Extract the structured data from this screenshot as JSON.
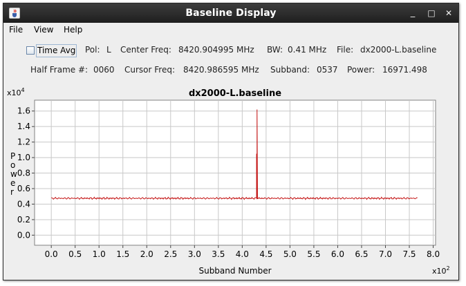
{
  "window": {
    "title": "Baseline Display"
  },
  "window_controls": {
    "minimize": "_",
    "maximize": "□",
    "close": "✕"
  },
  "menu": {
    "file": "File",
    "view": "View",
    "help": "Help"
  },
  "controls": {
    "time_avg_label": "Time Avg",
    "time_avg_checked": false
  },
  "info": {
    "pol_label": "Pol:",
    "pol_value": "L",
    "center_freq_label": "Center Freq:",
    "center_freq_value": "8420.904995 MHz",
    "bw_label": "BW:",
    "bw_value": "0.41 MHz",
    "file_label": "File:",
    "file_value": "dx2000-L.baseline",
    "half_frame_label": "Half Frame #:",
    "half_frame_value": "0060",
    "cursor_freq_label": "Cursor Freq:",
    "cursor_freq_value": "8420.986595 MHz",
    "subband_label": "Subband:",
    "subband_value": "0537",
    "power_label": "Power:",
    "power_value": "16971.498"
  },
  "icons": {
    "app": "java-cup-icon"
  },
  "colors": {
    "series": "#c41414",
    "grid": "#c8c8c8",
    "plot_bg": "#ffffff"
  },
  "chart_data": {
    "type": "line",
    "title": "dx2000-L.baseline",
    "xlabel": "Subband Number",
    "ylabel": "Power",
    "x_multiplier": "x10",
    "x_multiplier_exp": "2",
    "y_multiplier": "x10",
    "y_multiplier_exp": "4",
    "xlim": [
      -0.35,
      8.05
    ],
    "ylim": [
      -0.13,
      1.74
    ],
    "x_ticks": [
      "0.0",
      "0.5",
      "1.0",
      "1.5",
      "2.0",
      "2.5",
      "3.0",
      "3.5",
      "4.0",
      "4.5",
      "5.0",
      "5.5",
      "6.0",
      "6.5",
      "7.0",
      "7.5",
      "8.0"
    ],
    "y_ticks": [
      "0.0",
      "0.2",
      "0.4",
      "0.6",
      "0.8",
      "1.0",
      "1.2",
      "1.4",
      "1.6"
    ],
    "grid": true,
    "series": [
      {
        "x_range": [
          0.0,
          7.67
        ],
        "baseline": 0.475,
        "points": [
          [
            4.3,
            0.48
          ],
          [
            4.3,
            1.05
          ],
          [
            4.31,
            0.49
          ],
          [
            4.31,
            1.62
          ],
          [
            4.32,
            0.48
          ]
        ]
      }
    ]
  }
}
